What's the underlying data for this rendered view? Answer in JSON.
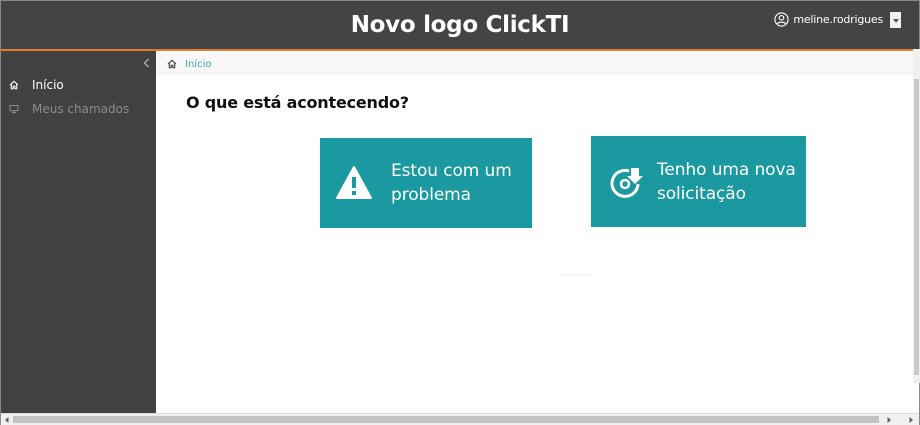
{
  "header": {
    "title": "Novo logo ClickTI",
    "username": "meline.rodrigues",
    "user_icon": "user-circle-icon",
    "dropdown_icon": "caret-down-icon"
  },
  "sidebar": {
    "collapse_icon": "chevron-left-icon",
    "items": [
      {
        "label": "Início",
        "icon": "home-icon",
        "active": true
      },
      {
        "label": "Meus chamados",
        "icon": "monitor-icon",
        "active": false
      }
    ]
  },
  "breadcrumb": {
    "icon": "home-icon",
    "items": [
      "Início"
    ]
  },
  "main": {
    "question": "O que está acontecendo?",
    "actions": [
      {
        "label_line1": "Estou com um",
        "label_line2": "problema",
        "icon": "warning-triangle-icon"
      },
      {
        "label_line1": "Tenho uma nova",
        "label_line2": "solicitação",
        "icon": "disc-download-icon"
      }
    ]
  },
  "colors": {
    "header_bg": "#444444",
    "accent_orange": "#e8782b",
    "sidebar_bg": "#414141",
    "button_teal": "#1a9aa0",
    "breadcrumb_link": "#3aa9b3"
  }
}
